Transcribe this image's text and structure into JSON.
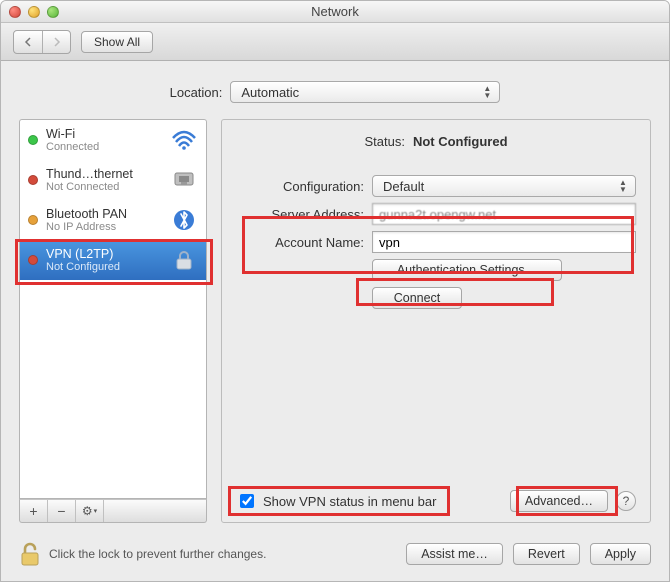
{
  "window": {
    "title": "Network"
  },
  "toolbar": {
    "show_all": "Show All"
  },
  "location": {
    "label": "Location:",
    "value": "Automatic"
  },
  "sidebar": {
    "items": [
      {
        "name": "Wi-Fi",
        "status": "Connected",
        "dot": "green",
        "icon": "wifi"
      },
      {
        "name": "Thund…thernet",
        "status": "Not Connected",
        "dot": "red",
        "icon": "ethernet"
      },
      {
        "name": "Bluetooth PAN",
        "status": "No IP Address",
        "dot": "orange",
        "icon": "bluetooth"
      },
      {
        "name": "VPN (L2TP)",
        "status": "Not Configured",
        "dot": "red",
        "icon": "vpn",
        "selected": true
      }
    ],
    "buttons": {
      "add": "+",
      "remove": "−",
      "gear": "⚙"
    }
  },
  "detail": {
    "status_label": "Status:",
    "status_value": "Not Configured",
    "configuration_label": "Configuration:",
    "configuration_value": "Default",
    "server_label": "Server Address:",
    "server_value": "gunna2t.opengw.net",
    "account_label": "Account Name:",
    "account_value": "vpn",
    "auth_button": "Authentication Settings…",
    "connect_button": "Connect",
    "show_status_label": "Show VPN status in menu bar",
    "show_status_checked": true,
    "advanced_button": "Advanced…",
    "help_button": "?"
  },
  "footer": {
    "lock_text": "Click the lock to prevent further changes.",
    "assist": "Assist me…",
    "revert": "Revert",
    "apply": "Apply"
  }
}
